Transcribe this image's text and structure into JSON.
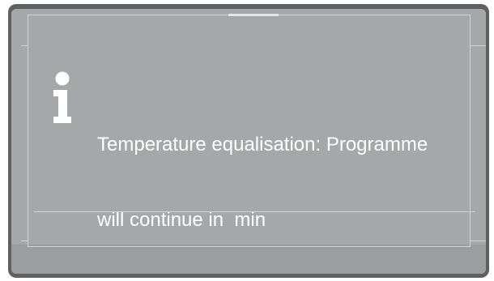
{
  "dialog": {
    "message_line1": "Temperature equalisation: Programme",
    "message_line2": "will continue in  min",
    "icon": "info-icon"
  },
  "colors": {
    "device_bezel": "#5f6062",
    "screen_background": "#a6a7a9",
    "text": "#ffffff",
    "frame_lines": "#d2d3d5"
  }
}
